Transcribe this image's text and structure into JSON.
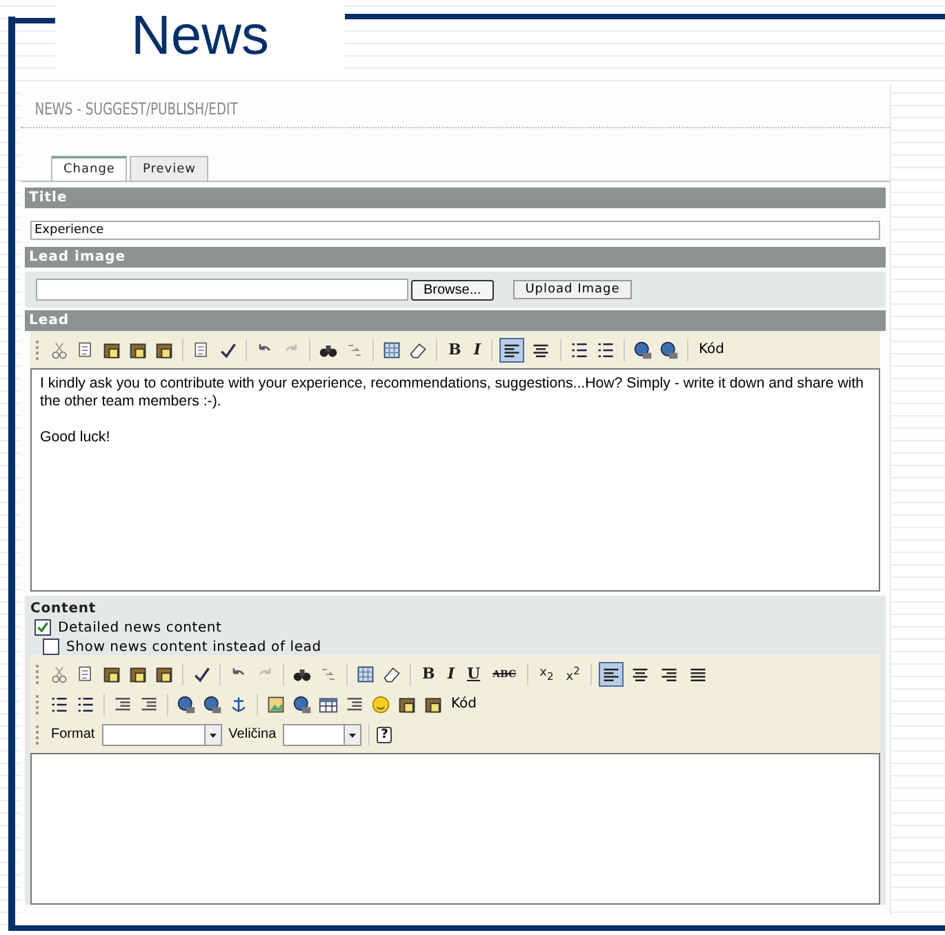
{
  "slide": {
    "title": "News"
  },
  "page": {
    "heading": "NEWS - SUGGEST/PUBLISH/EDIT",
    "tabs": [
      {
        "label": "Change",
        "selected": true
      },
      {
        "label": "Preview",
        "selected": false
      }
    ],
    "title_section": {
      "label": "Title",
      "value": "Experience"
    },
    "lead_image_section": {
      "label": "Lead image",
      "browse_button": "Browse...",
      "upload_button": "Upload Image"
    },
    "lead_section": {
      "label": "Lead",
      "format_buttons": [
        "B",
        "I"
      ],
      "alignment_buttons": [
        {
          "selected": true
        },
        {
          "selected": false
        }
      ],
      "code_button": "Kód",
      "paragraphs": [
        "I kindly ask you to contribute with your experience, recommendations, suggestions...How? Simply - write it down and share with the other team members :-).",
        "Good luck!"
      ]
    },
    "content_section": {
      "label": "Content",
      "checkboxes": [
        {
          "label": "Detailed news content",
          "checked": true
        },
        {
          "label": "Show news content instead of lead",
          "checked": false
        }
      ],
      "format_buttons": [
        "B",
        "I",
        "U",
        "ABC"
      ],
      "script_buttons": [
        "x$_{2}$",
        "x$^{2}$"
      ],
      "alignment_buttons": [
        {
          "selected": true
        },
        {
          "selected": false
        },
        {
          "selected": false
        },
        {
          "selected": false
        }
      ],
      "code_button": "Kód",
      "format_label": "Format",
      "size_label": "Veličina",
      "help_button": "?"
    }
  }
}
